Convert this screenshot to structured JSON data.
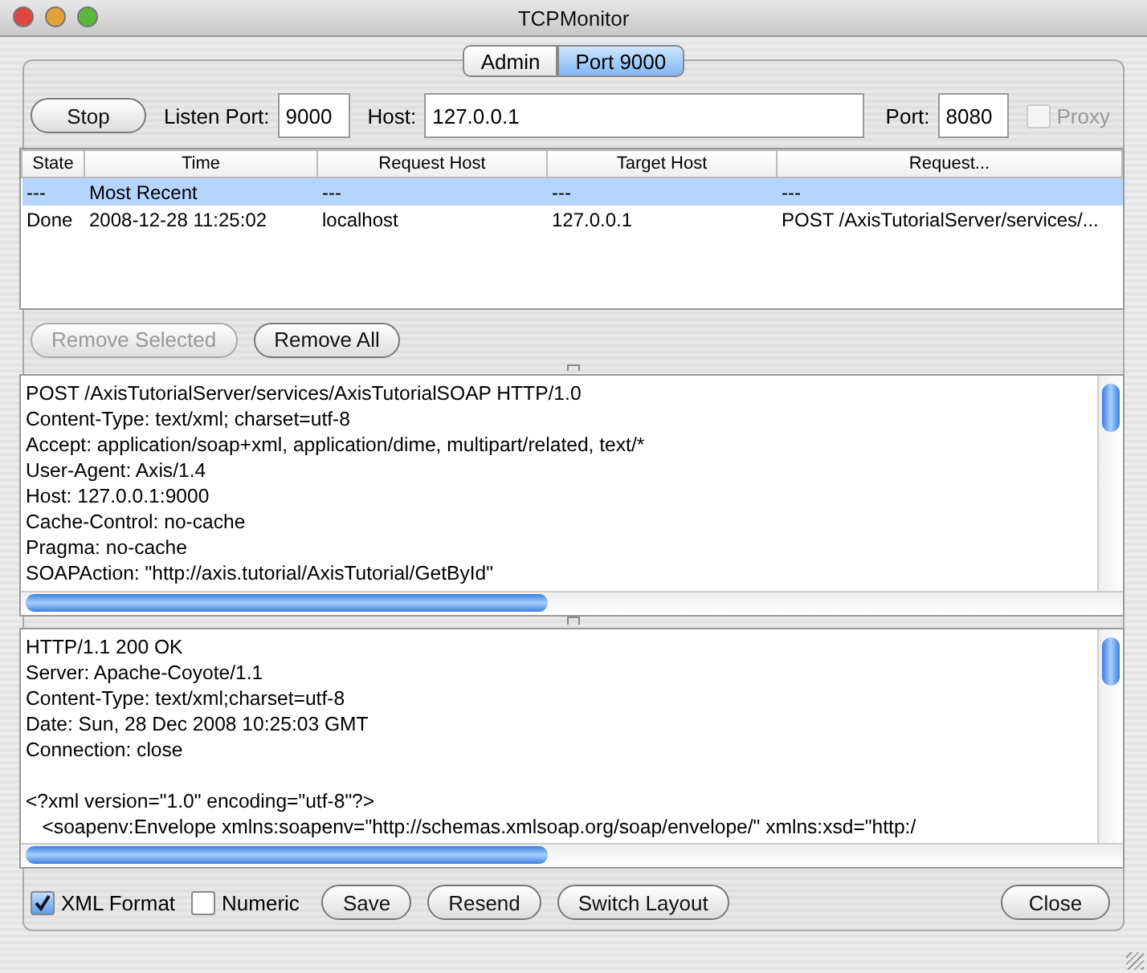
{
  "window": {
    "title": "TCPMonitor"
  },
  "tabs": [
    {
      "label": "Admin",
      "selected": false
    },
    {
      "label": "Port 9000",
      "selected": true
    }
  ],
  "listener": {
    "stop_button": "Stop",
    "listen_port_label": "Listen Port:",
    "listen_port": "9000",
    "host_label": "Host:",
    "host": "127.0.0.1",
    "port_label": "Port:",
    "port": "8080",
    "proxy": {
      "label": "Proxy",
      "checked": false,
      "disabled": true
    }
  },
  "table": {
    "columns": [
      "State",
      "Time",
      "Request Host",
      "Target Host",
      "Request..."
    ],
    "rows": [
      {
        "cells": [
          "---",
          "Most Recent",
          "---",
          "---",
          "---"
        ],
        "selected": true
      },
      {
        "cells": [
          "Done",
          "2008-12-28 11:25:02",
          "localhost",
          "127.0.0.1",
          "POST /AxisTutorialServer/services/..."
        ],
        "selected": false
      }
    ]
  },
  "table_buttons": [
    {
      "label": "Remove Selected",
      "disabled": true
    },
    {
      "label": "Remove All",
      "disabled": false
    }
  ],
  "request_text": "POST /AxisTutorialServer/services/AxisTutorialSOAP HTTP/1.0\nContent-Type: text/xml; charset=utf-8\nAccept: application/soap+xml, application/dime, multipart/related, text/*\nUser-Agent: Axis/1.4\nHost: 127.0.0.1:9000\nCache-Control: no-cache\nPragma: no-cache\nSOAPAction: \"http://axis.tutorial/AxisTutorial/GetById\"",
  "response_text": "HTTP/1.1 200 OK\nServer: Apache-Coyote/1.1\nContent-Type: text/xml;charset=utf-8\nDate: Sun, 28 Dec 2008 10:25:03 GMT\nConnection: close\n\n<?xml version=\"1.0\" encoding=\"utf-8\"?>\n   <soapenv:Envelope xmlns:soapenv=\"http://schemas.xmlsoap.org/soap/envelope/\" xmlns:xsd=\"http:/",
  "options": [
    {
      "label": "XML Format",
      "checked": true
    },
    {
      "label": "Numeric",
      "checked": false
    }
  ],
  "bottom_buttons": [
    {
      "label": "Save",
      "kind": "action"
    },
    {
      "label": "Resend",
      "kind": "action"
    },
    {
      "label": "Switch Layout",
      "kind": "action"
    },
    {
      "label": "Close",
      "kind": "close"
    }
  ]
}
